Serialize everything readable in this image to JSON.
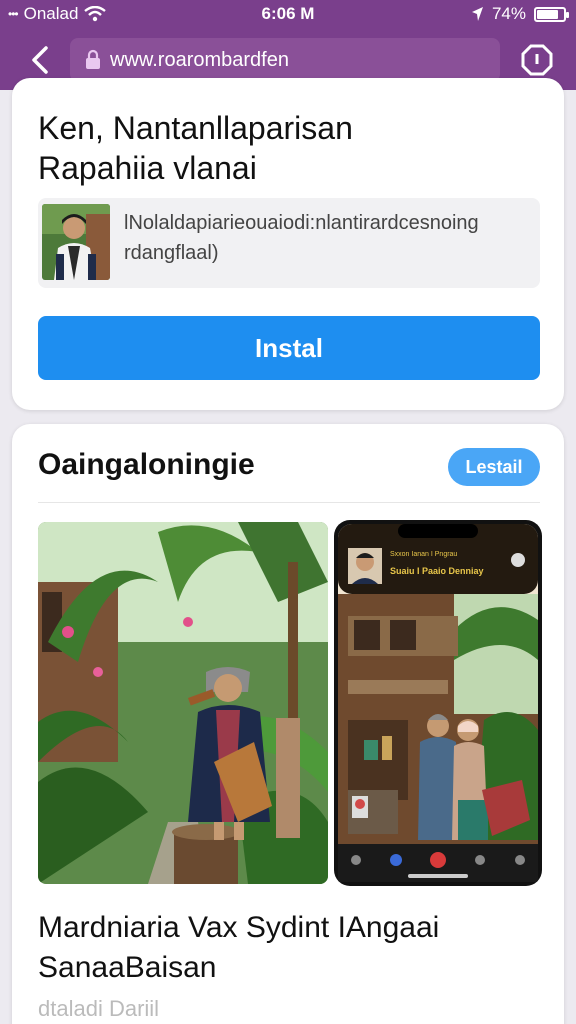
{
  "status_bar": {
    "carrier_dots": "•••",
    "carrier": "Onalad",
    "time": "6:06 M",
    "battery": "74%",
    "battery_level": 0.74
  },
  "browser": {
    "url": "www.roarombardfen"
  },
  "card1": {
    "title_line1": "Ken, Nantanllaparisan",
    "title_line2": "Rapahiia vlanai",
    "description_line1": "lNolaldapiarieouaiodi:nlantirardcesnoing",
    "description_line2": "rdangflaal)",
    "install_label": "Instal"
  },
  "card2": {
    "title": "Oaingaloningie",
    "install_label": "Lestail",
    "phone_banner_line1": "Sxxon Ianan I Pngrau",
    "phone_banner_line2": "Suaiu I Paaio Denniay",
    "text_line1": "Mardniaria Vax Sydint IAngaai",
    "text_line2": "SanaaBaisan",
    "subtext": "dtaladi Dariil"
  },
  "colors": {
    "brand_purple": "#7a3f8c",
    "install_blue": "#1e8ef0",
    "pill_blue": "#4aa6f6"
  }
}
